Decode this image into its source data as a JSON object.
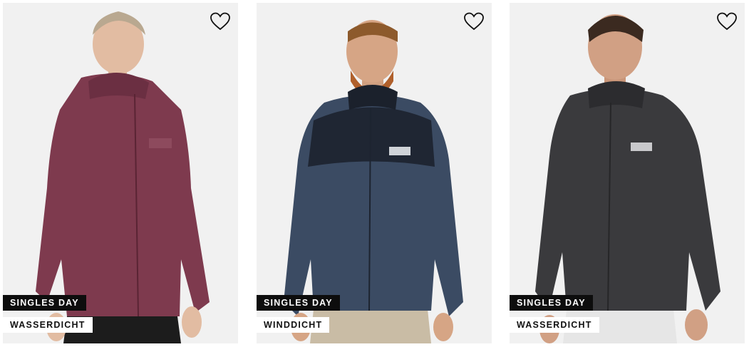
{
  "products": [
    {
      "promo_badge": "SINGLES DAY",
      "feature_badge": "WASSERDICHT",
      "jacket_color": "#7e3a4e",
      "wishlist_icon": "heart-outline-icon"
    },
    {
      "promo_badge": "SINGLES DAY",
      "feature_badge": "WINDDICHT",
      "jacket_color": "#3b4b63",
      "wishlist_icon": "heart-outline-icon"
    },
    {
      "promo_badge": "SINGLES DAY",
      "feature_badge": "WASSERDICHT",
      "jacket_color": "#3a3a3d",
      "wishlist_icon": "heart-outline-icon"
    }
  ]
}
